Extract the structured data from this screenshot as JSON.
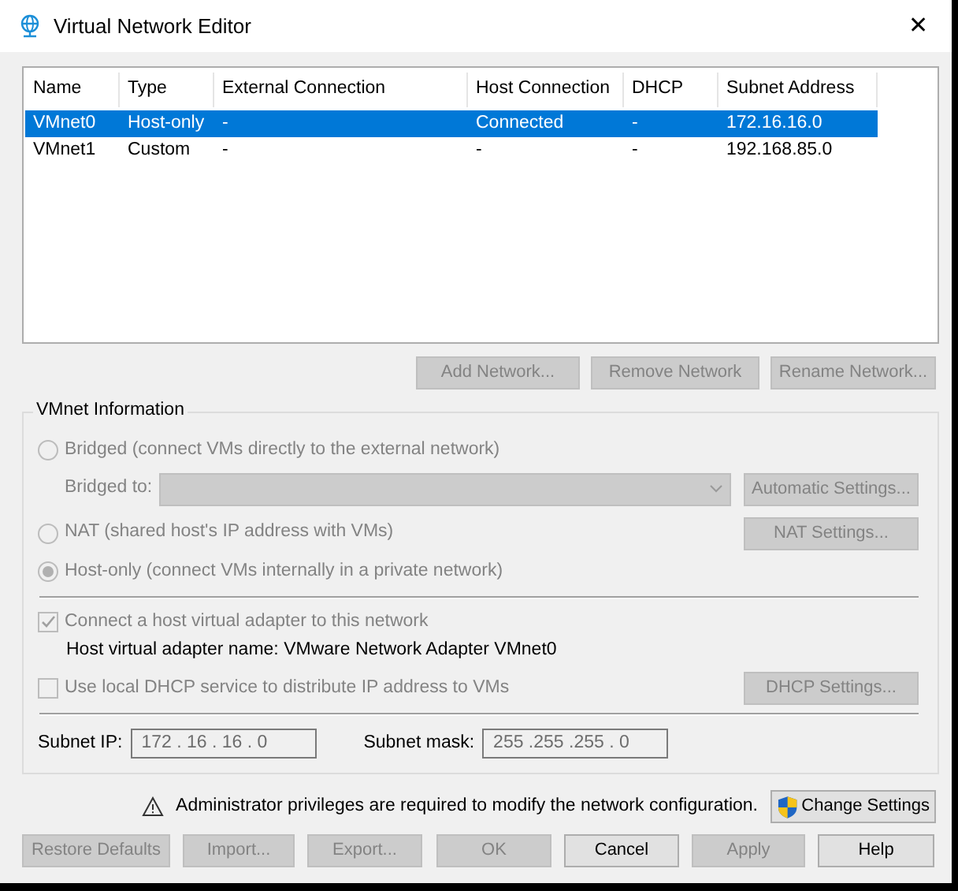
{
  "window": {
    "title": "Virtual Network Editor",
    "close": "✕"
  },
  "table": {
    "columns": [
      "Name",
      "Type",
      "External Connection",
      "Host Connection",
      "DHCP",
      "Subnet Address"
    ],
    "rows": [
      {
        "selected": true,
        "cells": [
          "VMnet0",
          "Host-only",
          "-",
          "Connected",
          "-",
          "172.16.16.0"
        ]
      },
      {
        "selected": false,
        "cells": [
          "VMnet1",
          "Custom",
          "-",
          "-",
          "-",
          "192.168.85.0"
        ]
      }
    ]
  },
  "network_buttons": [
    {
      "label": "Add Network...",
      "disabled": true
    },
    {
      "label": "Remove Network",
      "disabled": true
    },
    {
      "label": "Rename Network...",
      "disabled": true
    }
  ],
  "vmnet_information": {
    "title": "VMnet Information",
    "bridged": {
      "label": "Bridged (connect VMs directly to the external network)",
      "selected": false,
      "disabled": true
    },
    "bridged_to": {
      "label": "Bridged to:",
      "disabled": true
    },
    "automatic_settings": {
      "label": "Automatic Settings...",
      "disabled": true
    },
    "nat": {
      "label": "NAT (shared host's IP address with VMs)",
      "selected": false,
      "disabled": true
    },
    "nat_settings": {
      "label": "NAT Settings...",
      "disabled": true
    },
    "host_only": {
      "label": "Host-only (connect VMs internally in a private network)",
      "selected": true,
      "disabled": true
    },
    "connect_adapter": {
      "label": "Connect a host virtual adapter to this network",
      "checked": true,
      "disabled": true
    },
    "adapter_name": "Host virtual adapter name: VMware Network Adapter VMnet0",
    "use_dhcp": {
      "label": "Use local DHCP service to distribute IP address to VMs",
      "checked": false,
      "disabled": true
    },
    "dhcp_settings": {
      "label": "DHCP Settings...",
      "disabled": true
    },
    "subnet_ip": {
      "label": "Subnet IP:",
      "value": "172 . 16 . 16 . 0"
    },
    "subnet_mask": {
      "label": "Subnet mask:",
      "value": "255 .255 .255 . 0"
    }
  },
  "notice": "Administrator privileges are required to modify the network configuration.",
  "change_settings": {
    "label": "Change Settings",
    "disabled": false
  },
  "footer_buttons": [
    {
      "label": "Restore Defaults",
      "disabled": true
    },
    {
      "label": "Import...",
      "disabled": true
    },
    {
      "label": "Export...",
      "disabled": true
    },
    {
      "label": "OK",
      "disabled": true
    },
    {
      "label": "Cancel",
      "disabled": false
    },
    {
      "label": "Apply",
      "disabled": true
    },
    {
      "label": "Help",
      "disabled": false
    }
  ]
}
